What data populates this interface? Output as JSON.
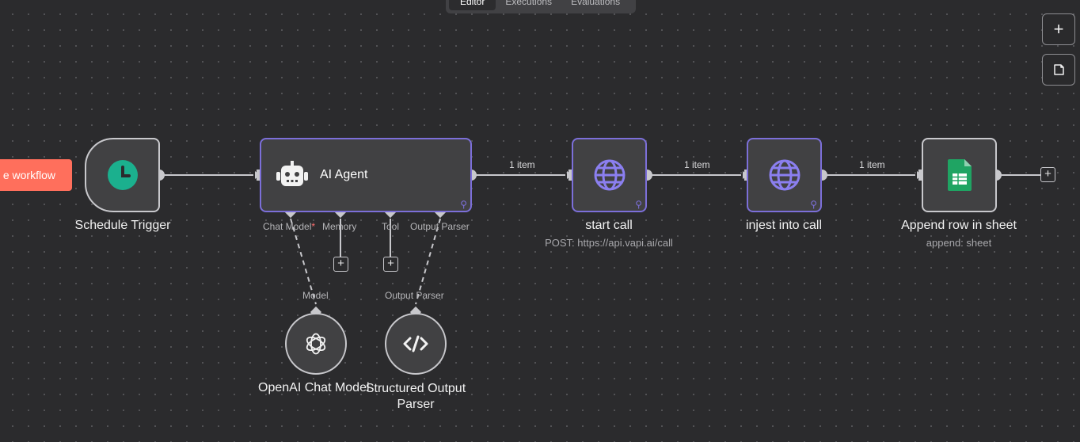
{
  "tabs": [
    "Editor",
    "Executions",
    "Evaluations"
  ],
  "controls": {
    "zoom_in_icon": "plus-icon",
    "sticky_icon": "sticky-note-icon"
  },
  "execute_button": {
    "label": "e workflow"
  },
  "nodes": {
    "schedule_trigger": {
      "label": "Schedule Trigger",
      "icon": "clock-icon",
      "color": "#1bb08e"
    },
    "ai_agent": {
      "label": "AI Agent",
      "icon": "robot-icon",
      "ports": {
        "chat_model": "Chat Model",
        "required_mark": "*",
        "memory": "Memory",
        "tool": "Tool",
        "output_parser": "Output Parser"
      }
    },
    "start_call": {
      "label": "start call",
      "sublabel": "POST: https://api.vapi.ai/call",
      "icon": "globe-icon"
    },
    "injest_call": {
      "label": "injest into call",
      "icon": "globe-icon"
    },
    "append_row": {
      "label": "Append row in sheet",
      "sublabel": "append: sheet",
      "icon": "google-sheets-icon",
      "color": "#1fa463"
    },
    "openai_model": {
      "label": "OpenAI Chat Model",
      "port_label": "Model",
      "icon": "openai-icon"
    },
    "output_parser": {
      "label": "Structured Output Parser",
      "port_label": "Output Parser",
      "icon": "code-icon"
    }
  },
  "edges": {
    "label_1": "1 item",
    "label_2": "1 item",
    "label_3": "1 item"
  },
  "colors": {
    "accent_purple": "#7c6fd9",
    "execute": "#ff6f5c",
    "canvas": "#2b2b2d"
  }
}
